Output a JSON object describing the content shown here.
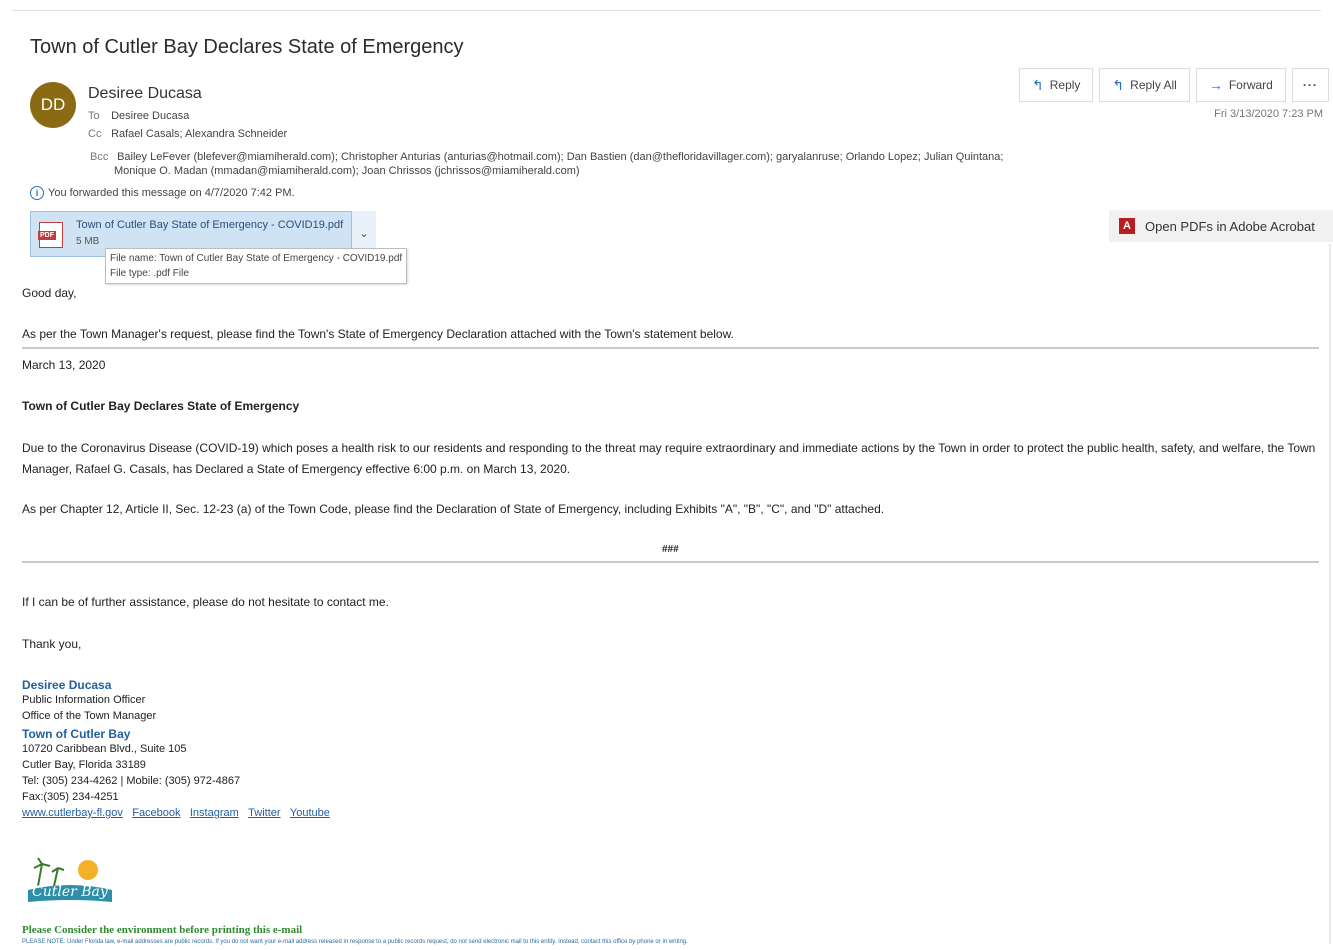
{
  "subject": "Town of Cutler Bay Declares State of Emergency",
  "sender": {
    "initials": "DD",
    "name": "Desiree Ducasa",
    "avatar_color": "#8a6a12"
  },
  "to": {
    "label": "To",
    "value": "Desiree Ducasa"
  },
  "cc": {
    "label": "Cc",
    "value": "Rafael Casals; Alexandra Schneider"
  },
  "bcc": {
    "label": "Bcc",
    "line1": "Bailey LeFever (blefever@miamiherald.com); Christopher Anturias (anturias@hotmail.com); Dan Bastien (dan@thefloridavillager.com); garyalanruse; Orlando Lopez; Julian Quintana;",
    "line2": "Monique O. Madan (mmadan@miamiherald.com); Joan Chrissos (jchrissos@miamiherald.com)"
  },
  "forwarded_note": "You forwarded this message on 4/7/2020 7:42 PM.",
  "actions": {
    "reply": "Reply",
    "reply_all": "Reply All",
    "forward": "Forward",
    "more": "···"
  },
  "date": "Fri 3/13/2020 7:23 PM",
  "attachment": {
    "name": "Town of Cutler Bay State of Emergency - COVID19.pdf",
    "size": "5 MB",
    "tooltip_name": "File name: Town of Cutler Bay State of Emergency - COVID19.pdf",
    "tooltip_type": "File type: .pdf File"
  },
  "open_pdf_label": "Open PDFs in Adobe Acrobat",
  "body": {
    "greeting": "Good day,",
    "intro": "As per the Town Manager's request, please find the Town's State of Emergency Declaration attached with the Town's statement below.",
    "date_line": "March 13, 2020",
    "heading": "Town of Cutler Bay Declares State of Emergency",
    "para1": "Due to the Coronavirus Disease (COVID-19) which poses a health risk to our residents and responding to the threat may require extraordinary and immediate actions by the Town in order to protect the public health, safety, and welfare, the Town Manager, Rafael G. Casals, has Declared a State of Emergency effective 6:00 p.m. on March 13, 2020.",
    "para2": "As per Chapter 12, Article II, Sec. 12-23 (a) of the Town Code, please find the Declaration of State of Emergency, including Exhibits \"A\", \"B\", \"C\", and \"D\" attached.",
    "hashes": "###",
    "closing1": "If I can be of further assistance, please do not hesitate to contact me.",
    "closing2": "Thank you,"
  },
  "signature": {
    "name": "Desiree Ducasa",
    "title": "Public Information Officer",
    "office": "Office of the Town Manager",
    "org": "Town of Cutler Bay",
    "address1": "10720 Caribbean Blvd., Suite 105",
    "address2": "Cutler Bay, Florida 33189",
    "phone": "Tel: (305) 234-4262 | Mobile: (305) 972-4867",
    "fax": "Fax:(305) 234-4251",
    "links": [
      "www.cutlerbay-fl.gov",
      "Facebook",
      "Instagram",
      "Twitter",
      "Youtube"
    ],
    "logo_text": "Cutler Bay"
  },
  "env_note": "Please Consider the environment before printing this e-mail",
  "public_note": "PLEASE NOTE: Under Florida law, e-mail addresses are public records. If you do not want your e-mail address released in response to a public records request, do not send electronic mail to this entity. Instead, contact this office by phone or in writing."
}
